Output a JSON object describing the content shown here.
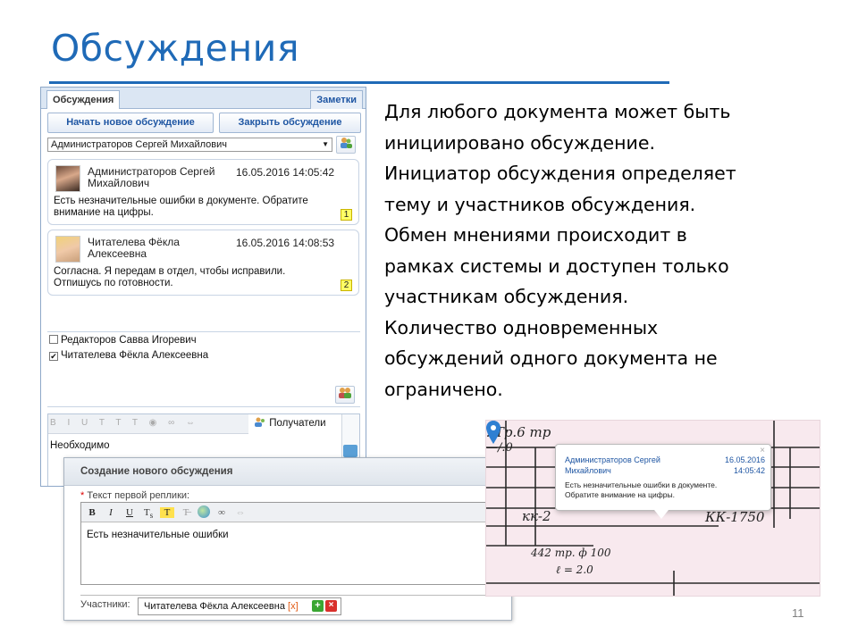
{
  "slide": {
    "title": "Обсуждения",
    "page_number": "11",
    "body_lines": [
      "Для любого документа может быть",
      "инициировано обсуждение.",
      "Инициатор обсуждения определяет",
      "тему и участников обсуждения.",
      "Обмен мнениями происходит в",
      "рамках системы и доступен только",
      "участникам обсуждения.",
      "Количество одновременных",
      "обсуждений одного документа не",
      "ограничено."
    ]
  },
  "panel": {
    "tab_discussions": "Обсуждения",
    "tab_notes": "Заметки",
    "start_button": "Начать новое обсуждение",
    "close_button": "Закрыть обсуждение",
    "selected_discussion": "Администраторов Сергей Михайлович",
    "messages": [
      {
        "author_line1": "Администраторов Сергей",
        "author_line2": "Михайлович",
        "date": "16.05.2016 14:05:42",
        "text_line1": "Есть незначительные ошибки в документе. Обратите",
        "text_line2": "внимание на цифры.",
        "number": "1"
      },
      {
        "author_line1": "Читателева Фёкла",
        "author_line2": "Алексеевна",
        "date": "16.05.2016 14:08:53",
        "text_line1": "Согласна. Я передам в отдел, чтобы исправили.",
        "text_line2": "Отпишусь по готовности.",
        "number": "2"
      }
    ],
    "participants": [
      {
        "name": "Редакторов Савва Игоревич",
        "checked": false
      },
      {
        "name": "Читателева Фёкла Алексеевна",
        "checked": true
      }
    ],
    "recipients_label": "Получатели",
    "editor_text": "Необходимо"
  },
  "dialog": {
    "title": "Создание нового обсуждения",
    "close": "×",
    "first_reply_label": "Текст первой реплики:",
    "required_mark": "*",
    "first_reply_text": "Есть незначительные ошибки",
    "participants_label": "Участники:",
    "participant_name": "Читателева Фёкла Алексеевна",
    "remove_mark": "[x]"
  },
  "drawing_popup": {
    "author_line1": "Администраторов Сергей",
    "author_line2": "Михайлович",
    "date": "16.05.2016",
    "time": "14:05:42",
    "text_line1": "Есть незначительные ошибки в документе.",
    "text_line2": "Обратите внимание на цифры.",
    "close": "×"
  },
  "colors": {
    "title_blue": "#1f6ab7",
    "link_blue": "#1f56a3",
    "drawing_bg": "#f8e9ee",
    "pin_blue": "#2f7fd2"
  }
}
